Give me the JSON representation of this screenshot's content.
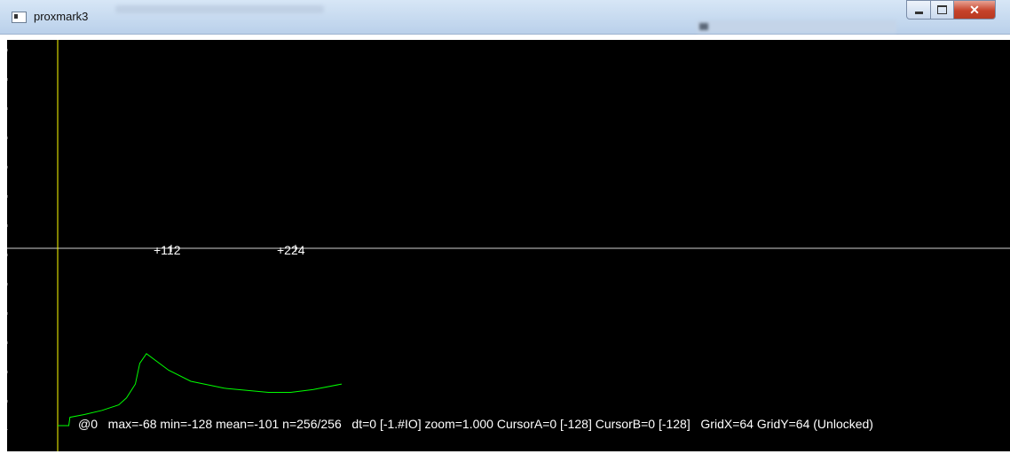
{
  "window": {
    "title": "proxmark3"
  },
  "plot": {
    "background": "#000000",
    "cursor_color": "#ffff00",
    "trace_color": "#00ff00",
    "axis_color": "#ffffff",
    "tick_labels": [
      "+112",
      "+224"
    ],
    "status": {
      "pos": "@0",
      "stats": "max=-68 min=-128 mean=-101 n=256/256",
      "dt_zoom": "dt=0 [-1.#IO] zoom=1.000 CursorA=0 [-128] CursorB=0 [-128]",
      "grid": "GridX=64 GridY=64 (Unlocked)"
    }
  },
  "chart_data": {
    "type": "line",
    "title": "",
    "xlabel": "",
    "ylabel": "",
    "xlim": [
      0,
      256
    ],
    "ylim": [
      -128,
      127
    ],
    "x": [
      0,
      10,
      11,
      24,
      40,
      55,
      62,
      70,
      74,
      80,
      100,
      120,
      150,
      190,
      210,
      230,
      256
    ],
    "y": [
      -128,
      -128,
      -122,
      -120,
      -117,
      -113,
      -108,
      -98,
      -83,
      -76,
      -88,
      -96,
      -101,
      -104,
      -104,
      -102,
      -98
    ]
  },
  "titlebar_icons": [
    "app-icon",
    "minimize-icon",
    "maximize-icon",
    "close-icon"
  ]
}
